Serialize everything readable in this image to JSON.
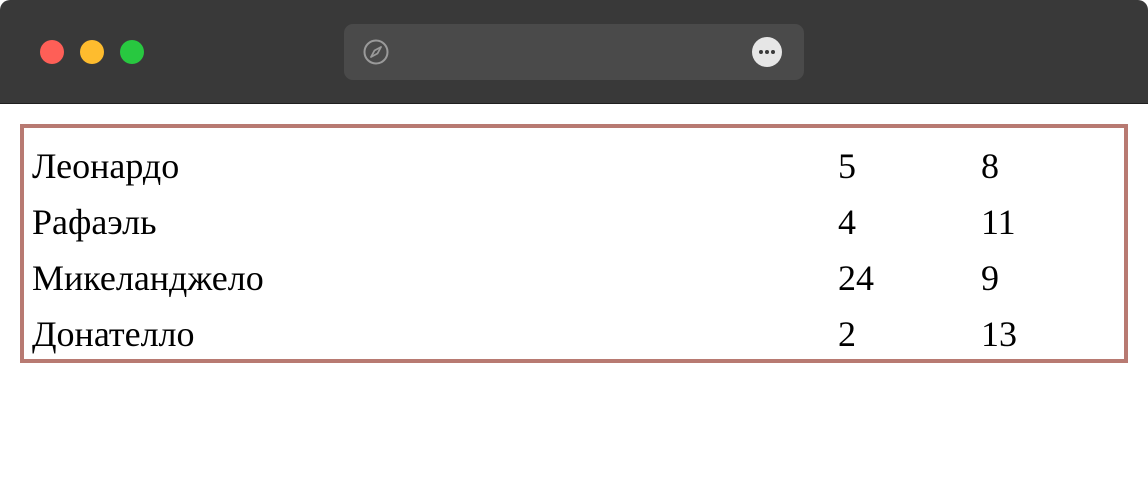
{
  "window": {
    "traffic_lights": {
      "close_color": "#fe5f57",
      "minimize_color": "#febc2e",
      "zoom_color": "#28c840"
    },
    "address_bar": {
      "url": "",
      "left_icon": "compass-icon",
      "right_icon": "more-options-icon"
    }
  },
  "table": {
    "border_color": "#b87a72",
    "rows": [
      {
        "name": "Леонардо",
        "a": "5",
        "b": "8"
      },
      {
        "name": "Рафаэль",
        "a": "4",
        "b": "11"
      },
      {
        "name": "Микеланджело",
        "a": "24",
        "b": "9"
      },
      {
        "name": "Донателло",
        "a": "2",
        "b": "13"
      }
    ]
  }
}
